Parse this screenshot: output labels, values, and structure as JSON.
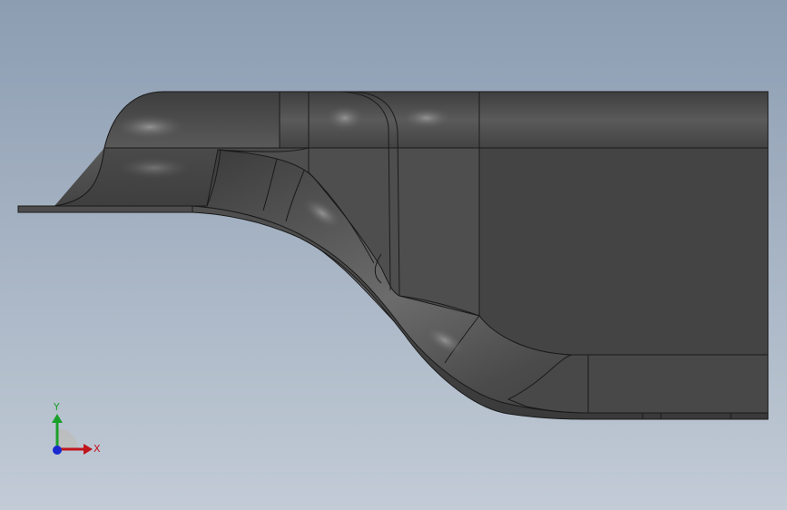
{
  "viewport": {
    "background_top": "#8c9db2",
    "background_bottom": "#c2cbd6"
  },
  "model": {
    "face_color": "#4a4a4a",
    "edge_color": "#1a1a1a",
    "highlight_color": "#8a8a8a"
  },
  "triad": {
    "x_label": "X",
    "y_label": "Y",
    "x_color": "#c0141c",
    "y_color": "#1aa02a",
    "z_color": "#1a2ad0"
  }
}
